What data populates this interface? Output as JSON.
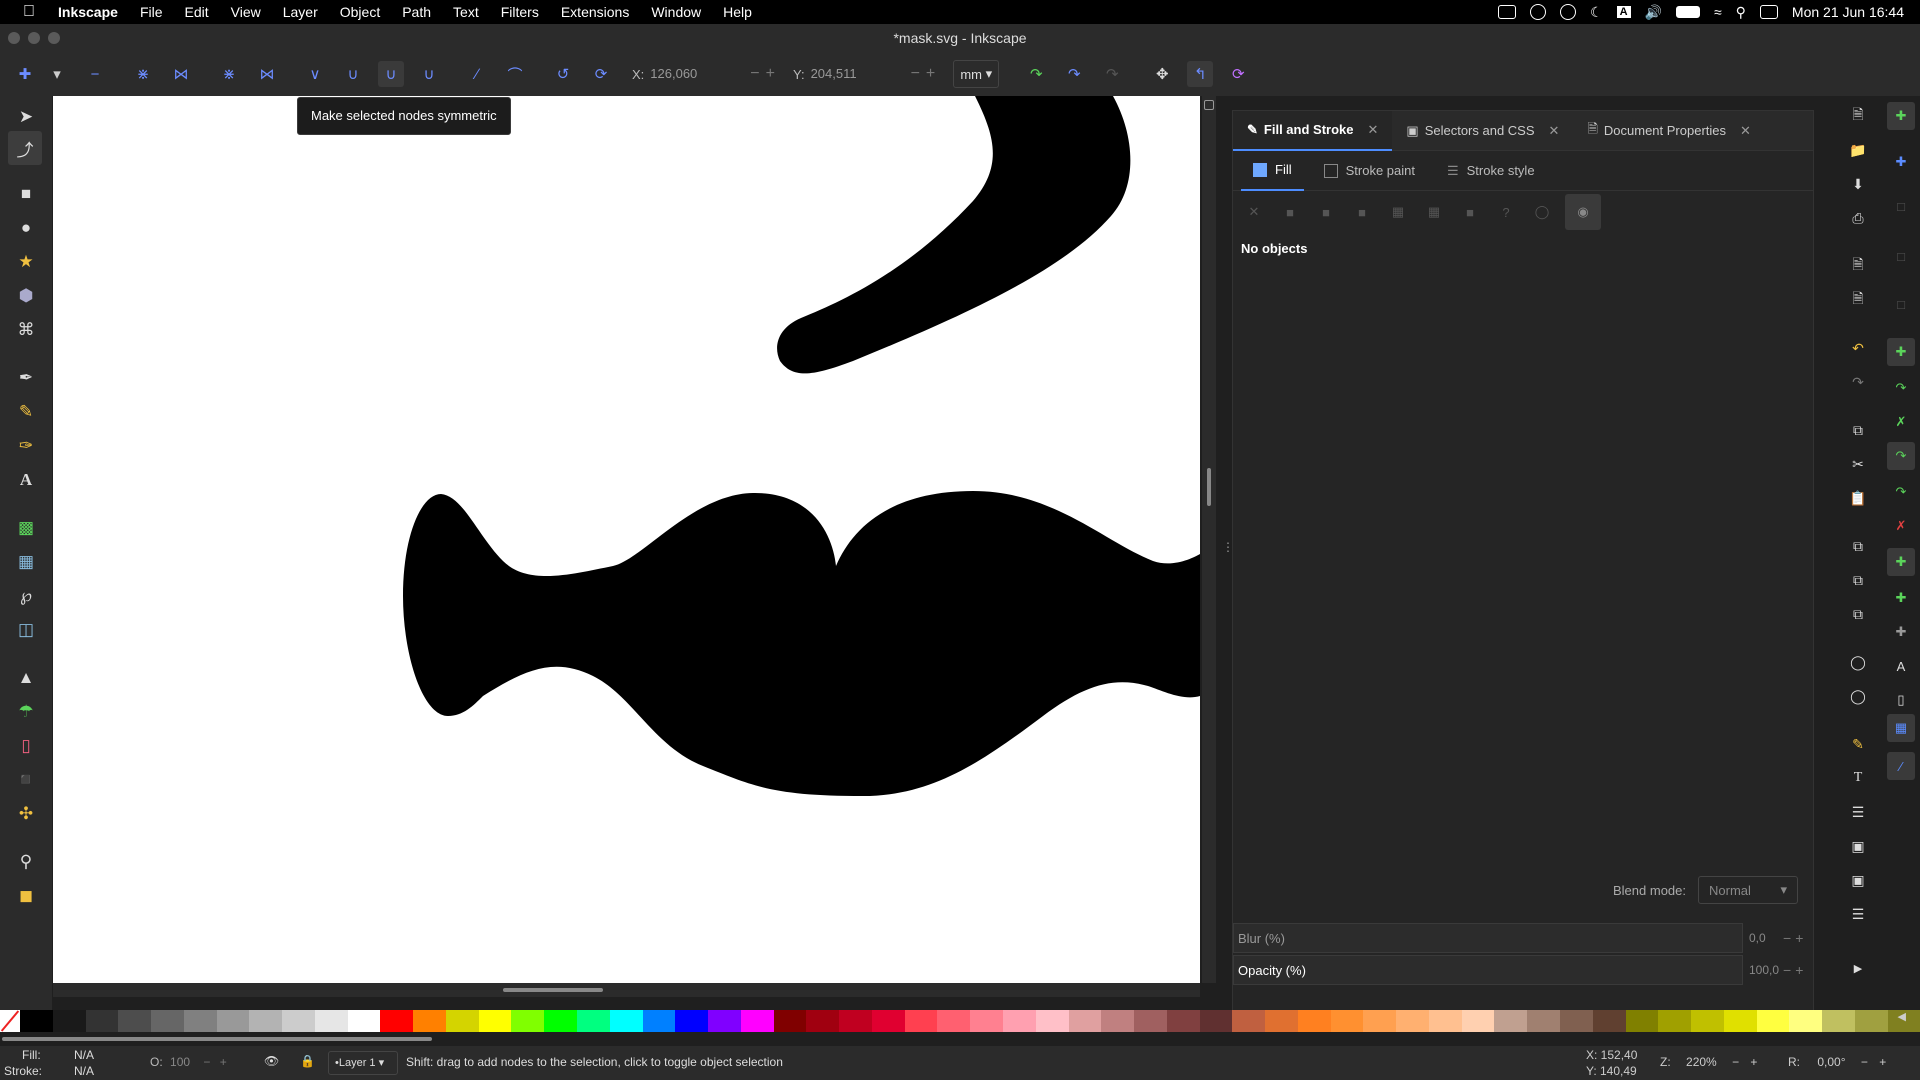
{
  "menubar": {
    "app": "Inkscape",
    "items": [
      "File",
      "Edit",
      "View",
      "Layer",
      "Object",
      "Path",
      "Text",
      "Filters",
      "Extensions",
      "Window",
      "Help"
    ],
    "clock": "Mon 21 Jun  16:44"
  },
  "window": {
    "title": "*mask.svg - Inkscape"
  },
  "toolbar": {
    "x_label": "X:",
    "x_value": "126,060",
    "y_label": "Y:",
    "y_value": "204,511",
    "unit": "mm"
  },
  "tooltip": "Make selected nodes symmetric",
  "dock": {
    "tabs": [
      {
        "label": "Fill and Stroke",
        "icon": "fill-stroke-icon"
      },
      {
        "label": "Selectors and CSS",
        "icon": "selectors-icon"
      },
      {
        "label": "Document Properties",
        "icon": "document-icon"
      }
    ],
    "subtabs": [
      "Fill",
      "Stroke paint",
      "Stroke style"
    ],
    "no_objects": "No objects",
    "blend_label": "Blend mode:",
    "blend_value": "Normal",
    "blur_label": "Blur (%)",
    "blur_value": "0,0",
    "opacity_label": "Opacity (%)",
    "opacity_value": "100,0"
  },
  "statusbar": {
    "fill_label": "Fill:",
    "fill_value": "N/A",
    "stroke_label": "Stroke:",
    "stroke_value": "N/A",
    "opacity_label": "O:",
    "opacity_value": "100",
    "layer": "•Layer 1",
    "message": "Shift: drag to add nodes to the selection, click to toggle object selection",
    "cursor_x": "X:  152,40",
    "cursor_y": "Y:  140,49",
    "zoom_label": "Z:",
    "zoom_value": "220%",
    "rotation_label": "R:",
    "rotation_value": "0,00°"
  },
  "palette": [
    "#000000",
    "#1a1a1a",
    "#333333",
    "#4d4d4d",
    "#666666",
    "#808080",
    "#999999",
    "#b3b3b3",
    "#cccccc",
    "#e6e6e6",
    "#ffffff",
    "#ff0000",
    "#ff8000",
    "#d4d400",
    "#ffff00",
    "#80ff00",
    "#00ff00",
    "#00ff80",
    "#00ffff",
    "#0080ff",
    "#0000ff",
    "#8000ff",
    "#ff00ff",
    "#800000",
    "#a00010",
    "#c00020",
    "#e00030",
    "#ff4050",
    "#ff6070",
    "#ff8090",
    "#ffa0b0",
    "#ffc0c8",
    "#e0a0a0",
    "#c08080",
    "#a06060",
    "#804040",
    "#603030",
    "#c06040",
    "#e07030",
    "#ff8020",
    "#ff9030",
    "#ffa050",
    "#ffb070",
    "#ffc090",
    "#ffd0b0",
    "#c0a090",
    "#a08070",
    "#806050",
    "#604030",
    "#808000",
    "#a0a000",
    "#c0c000",
    "#e0e000",
    "#ffff40",
    "#ffff80",
    "#c0c060",
    "#a0a040",
    "#808020"
  ]
}
